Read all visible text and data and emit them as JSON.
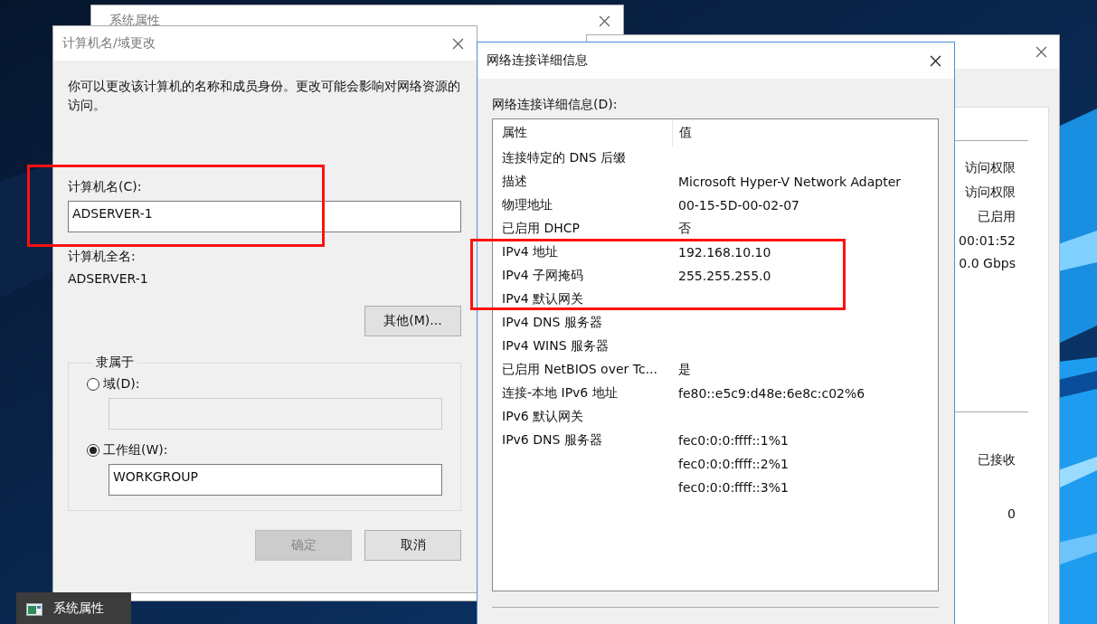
{
  "background_window": {
    "title": "系统属性"
  },
  "status_window": {
    "sections": [
      {
        "items": [
          "访问权限",
          "访问权限",
          "已启用",
          "00:01:52",
          "0.0 Gbps"
        ]
      },
      {
        "items": [
          "已接收",
          "0"
        ]
      }
    ]
  },
  "name_dialog": {
    "title": "计算机名/域更改",
    "description": "你可以更改该计算机的名称和成员身份。更改可能会影响对网络资源的访问。",
    "computer_name": {
      "label": "计算机名(C):",
      "value": "ADSERVER-1"
    },
    "full_name": {
      "label": "计算机全名:",
      "value": "ADSERVER-1"
    },
    "more_button": "其他(M)...",
    "member_of": {
      "legend": "隶属于",
      "options": [
        {
          "label": "域(D):",
          "selected": false
        },
        {
          "label": "工作组(W):",
          "selected": true,
          "value": "WORKGROUP"
        }
      ]
    },
    "buttons": [
      {
        "label": "确定",
        "disabled": true
      },
      {
        "label": "取消",
        "disabled": false
      }
    ]
  },
  "details_dialog": {
    "title": "网络连接详细信息",
    "list_label": "网络连接详细信息(D):",
    "columns": [
      "属性",
      "值"
    ],
    "rows": [
      {
        "property": "连接特定的 DNS 后缀"
      },
      {
        "property": "描述",
        "value": "Microsoft Hyper-V Network Adapter"
      },
      {
        "property": "物理地址",
        "value": "00-15-5D-00-02-07"
      },
      {
        "property": "已启用 DHCP",
        "value": "否"
      },
      {
        "property": "IPv4 地址",
        "value": "192.168.10.10"
      },
      {
        "property": "IPv4 子网掩码",
        "value": "255.255.255.0"
      },
      {
        "property": "IPv4 默认网关"
      },
      {
        "property": "IPv4 DNS 服务器"
      },
      {
        "property": "IPv4 WINS 服务器"
      },
      {
        "property": "已启用 NetBIOS over Tc...",
        "value": "是"
      },
      {
        "property": "连接-本地 IPv6 地址",
        "value": "fe80::e5c9:d48e:6e8c:c02%6"
      },
      {
        "property": "IPv6 默认网关"
      },
      {
        "property": "IPv6 DNS 服务器",
        "value": "fec0:0:0:ffff::1%1"
      },
      {
        "value": "fec0:0:0:ffff::2%1"
      },
      {
        "value": "fec0:0:0:ffff::3%1"
      }
    ]
  },
  "taskbar_preview": {
    "title": "系统属性"
  }
}
